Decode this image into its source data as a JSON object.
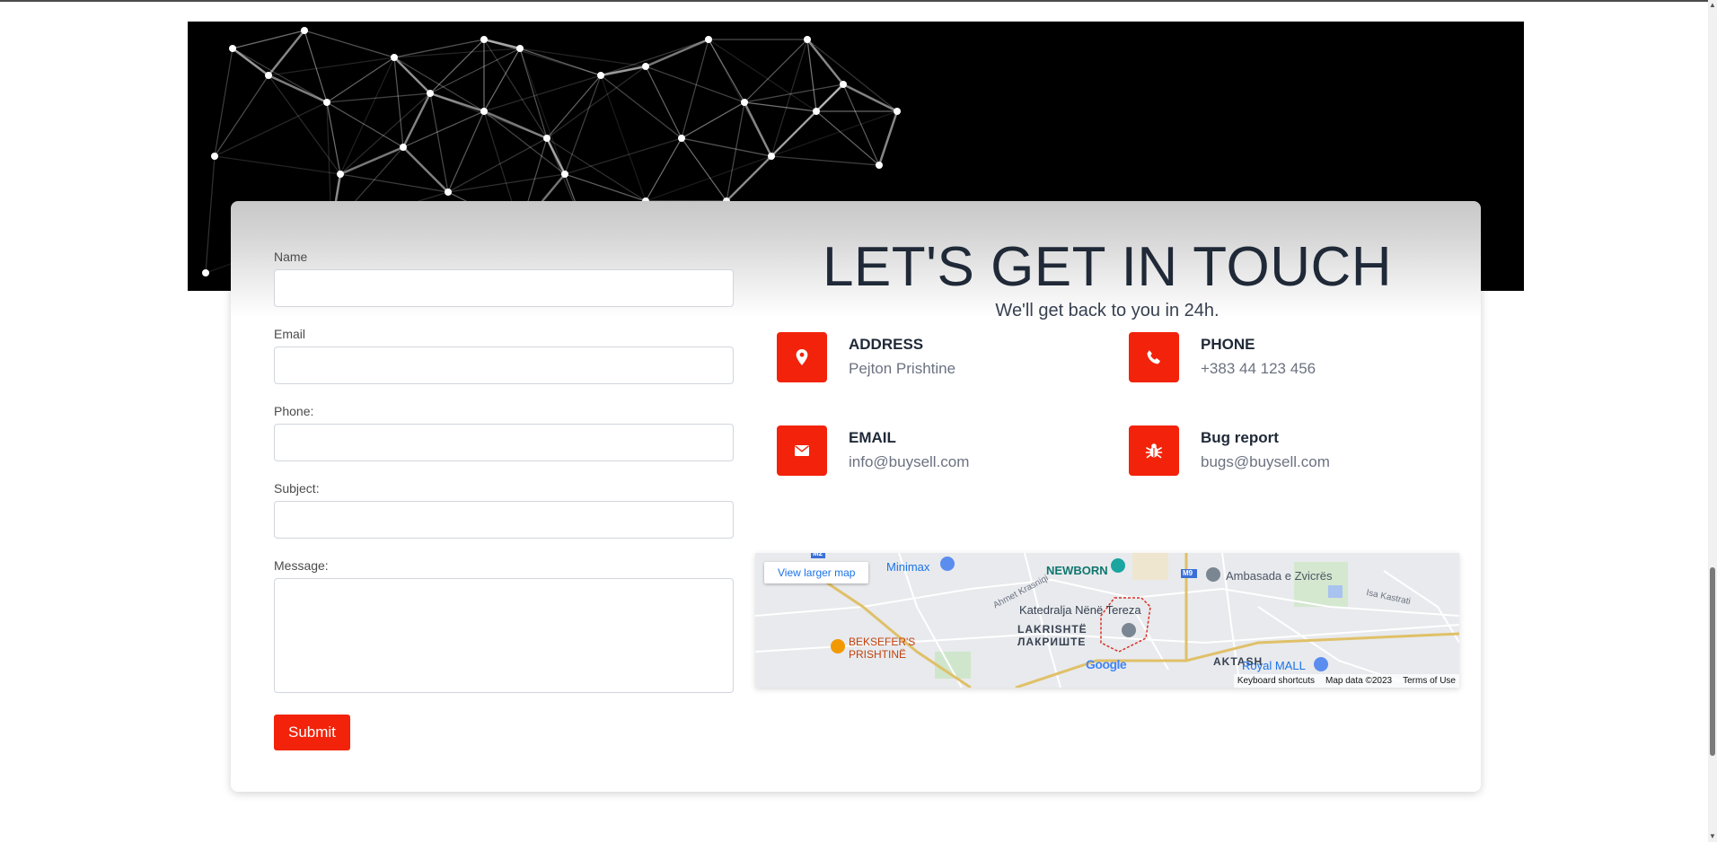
{
  "form": {
    "name_label": "Name",
    "email_label": "Email",
    "phone_label": "Phone:",
    "subject_label": "Subject:",
    "message_label": "Message:",
    "submit_label": "Submit"
  },
  "contact": {
    "heading": "LET'S GET IN TOUCH",
    "subheading": "We'll get back to you in 24h.",
    "items": [
      {
        "icon": "map-pin-icon",
        "title": "ADDRESS",
        "value": "Pejton Prishtine"
      },
      {
        "icon": "phone-icon",
        "title": "PHONE",
        "value": "+383 44 123 456"
      },
      {
        "icon": "envelope-icon",
        "title": "EMAIL",
        "value": "info@buysell.com"
      },
      {
        "icon": "bug-icon",
        "title": "Bug report",
        "value": "bugs@buysell.com"
      }
    ]
  },
  "map": {
    "view_larger": "View larger map",
    "labels": [
      "Minimax",
      "NEWBORN",
      "Ambasada e Zvicrës",
      "Katedralja Nënë Tereza",
      "LAKRISHTË",
      "ЛАКРИШТЕ",
      "BEKSEFER'S",
      "PRISHTINË",
      "AKTASH",
      "Royal MALL",
      "Isa Kastrati",
      "Ahmet Krasniqi",
      "M2",
      "M9"
    ],
    "logo": "Google",
    "footer": [
      "Keyboard shortcuts",
      "Map data ©2023",
      "Terms of Use"
    ]
  },
  "colors": {
    "accent": "#f2230a",
    "heading": "#1f2937",
    "muted": "#6b7280"
  }
}
